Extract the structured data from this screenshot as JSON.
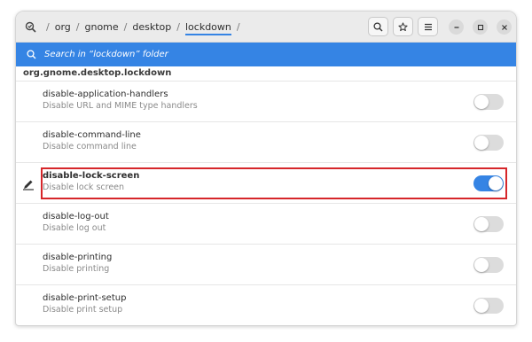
{
  "header": {
    "root_icon": "dconf-editor-icon",
    "path": [
      {
        "label": "org"
      },
      {
        "label": "gnome"
      },
      {
        "label": "desktop"
      },
      {
        "label": "lockdown"
      }
    ],
    "trailing_sep": "/",
    "buttons": {
      "search": "search-icon",
      "bookmark": "star-icon",
      "menu": "hamburger-menu-icon"
    },
    "window_controls": {
      "minimize": "minimize-icon",
      "maximize": "maximize-icon",
      "close": "close-icon"
    }
  },
  "search": {
    "placeholder": "Search in “lockdown” folder"
  },
  "schema": "org.gnome.desktop.lockdown",
  "rows": [
    {
      "key": "disable-application-handlers",
      "desc": "Disable URL and MIME type handlers",
      "enabled": false,
      "modified": false
    },
    {
      "key": "disable-command-line",
      "desc": "Disable command line",
      "enabled": false,
      "modified": false
    },
    {
      "key": "disable-lock-screen",
      "desc": "Disable lock screen",
      "enabled": true,
      "modified": true
    },
    {
      "key": "disable-log-out",
      "desc": "Disable log out",
      "enabled": false,
      "modified": false
    },
    {
      "key": "disable-printing",
      "desc": "Disable printing",
      "enabled": false,
      "modified": false
    },
    {
      "key": "disable-print-setup",
      "desc": "Disable print setup",
      "enabled": false,
      "modified": false
    }
  ],
  "colors": {
    "accent": "#3584e4",
    "highlight": "#d6262a",
    "header_bg": "#ebebeb"
  }
}
